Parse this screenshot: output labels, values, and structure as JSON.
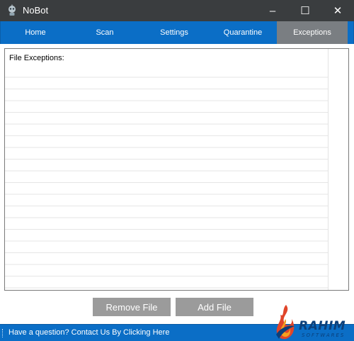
{
  "window": {
    "title": "NoBot",
    "icon": "robot-icon",
    "controls": {
      "minimize": "–",
      "maximize": "☐",
      "close": "✕"
    }
  },
  "tabs": [
    {
      "label": "Home",
      "active": false
    },
    {
      "label": "Scan",
      "active": false
    },
    {
      "label": "Settings",
      "active": false
    },
    {
      "label": "Quarantine",
      "active": false
    },
    {
      "label": "Exceptions",
      "active": true
    }
  ],
  "panel": {
    "header": "File Exceptions:",
    "items": []
  },
  "buttons": {
    "remove": "Remove File",
    "add": "Add File"
  },
  "status": {
    "text": "Have a question? Contact Us By Clicking Here"
  },
  "watermark": {
    "title": "RAHIM",
    "subtitle": "SOFTWARES"
  },
  "colors": {
    "titlebar": "#3a3d3f",
    "accent_blue": "#0b6ec6",
    "active_tab": "#7a7e82",
    "button_gray": "#9b9b9b"
  }
}
